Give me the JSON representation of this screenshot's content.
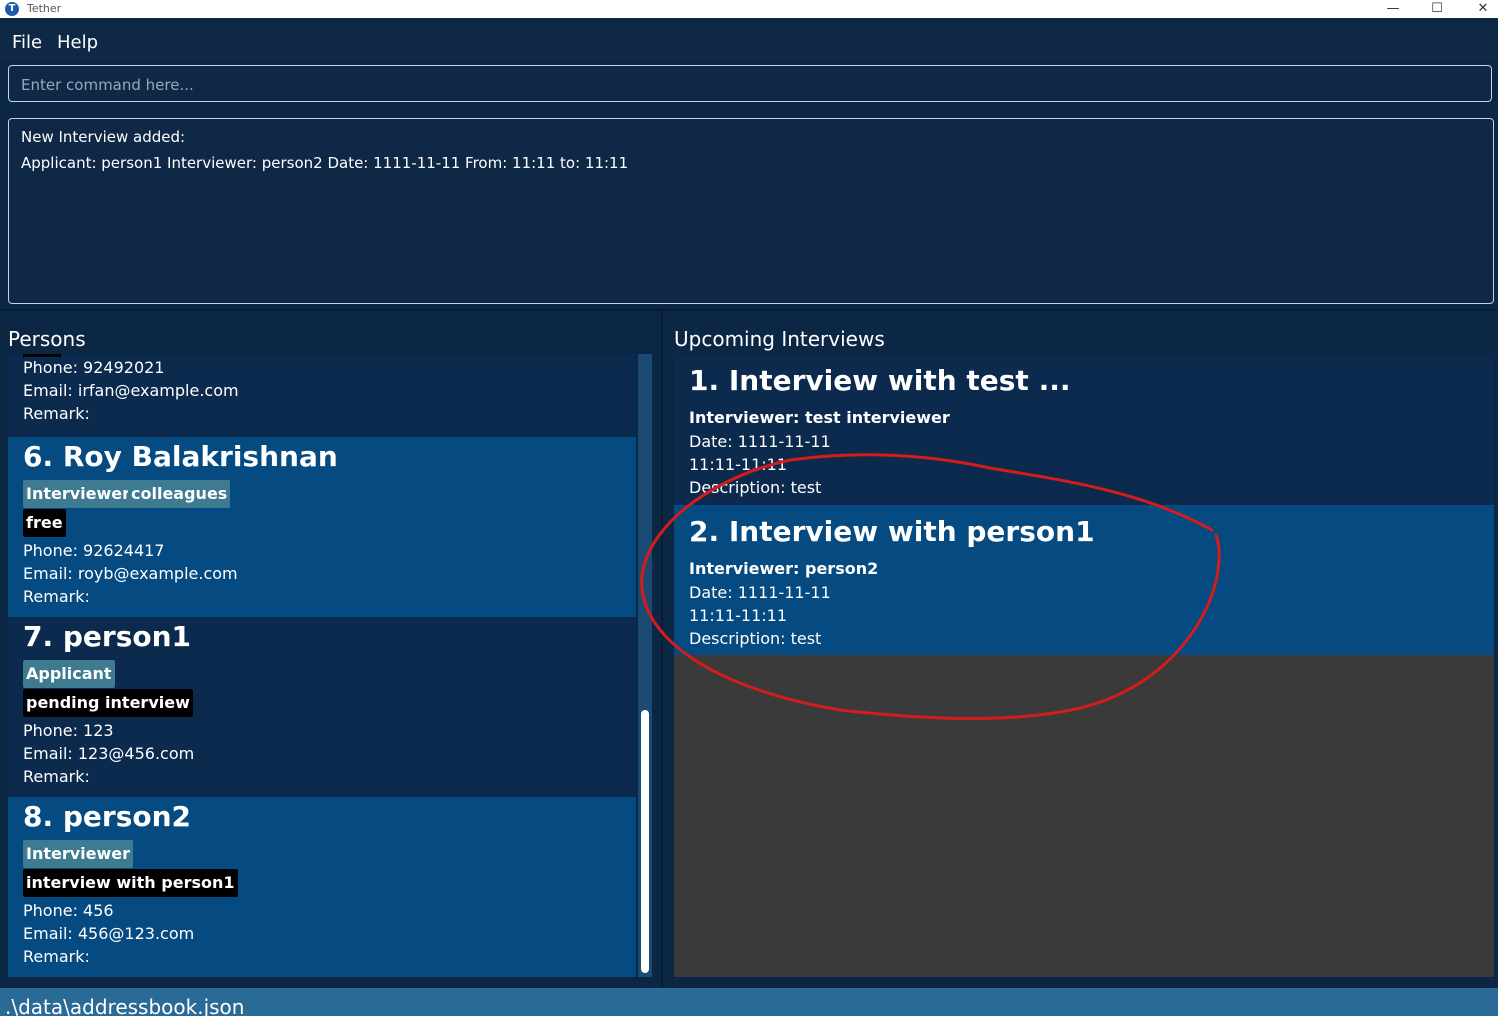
{
  "window": {
    "title": "Tether",
    "app_icon_letter": "T",
    "minimize": "—",
    "maximize": "☐",
    "close": "✕"
  },
  "menu": {
    "file": "File",
    "help": "Help"
  },
  "command": {
    "placeholder": "Enter command here..."
  },
  "result": {
    "line1": "New Interview added:",
    "line2": "Applicant: person1 Interviewer: person2 Date: 1111-11-11 From: 11:11 to: 11:11"
  },
  "persons": {
    "title": "Persons",
    "partial": {
      "phone": "Phone: 92492021",
      "email": "Email: irfan@example.com",
      "remark": "Remark:"
    },
    "items": [
      {
        "name": "6.  Roy Balakrishnan",
        "tags": [
          "Interviewer",
          "colleagues"
        ],
        "status": "free",
        "phone": "Phone: 92624417",
        "email": "Email: royb@example.com",
        "remark": "Remark:"
      },
      {
        "name": "7.  person1",
        "tags": [
          "Applicant"
        ],
        "status": "pending interview",
        "phone": "Phone: 123",
        "email": "Email: 123@456.com",
        "remark": "Remark:"
      },
      {
        "name": "8.  person2",
        "tags": [
          "Interviewer"
        ],
        "status": "interview with person1",
        "phone": "Phone: 456",
        "email": "Email: 456@123.com",
        "remark": "Remark:"
      }
    ]
  },
  "interviews": {
    "title": "Upcoming Interviews",
    "items": [
      {
        "title": "1.  Interview with test ...",
        "interviewer": "Interviewer: test interviewer",
        "date": "Date: 1111-11-11",
        "time": "11:11-11:11",
        "description": "Description: test"
      },
      {
        "title": "2.  Interview with person1",
        "interviewer": "Interviewer: person2",
        "date": "Date: 1111-11-11",
        "time": "11:11-11:11",
        "description": "Description: test"
      }
    ]
  },
  "status_bar": {
    "path": ".\\data\\addressbook.json"
  },
  "colors": {
    "background": "#0c2744",
    "card_dark": "#0b2a4e",
    "card_light": "#054a80",
    "tag": "#3e7b91",
    "status_tag": "#000000",
    "status_bar": "#2a6a97",
    "annotation": "#d41c1c"
  }
}
